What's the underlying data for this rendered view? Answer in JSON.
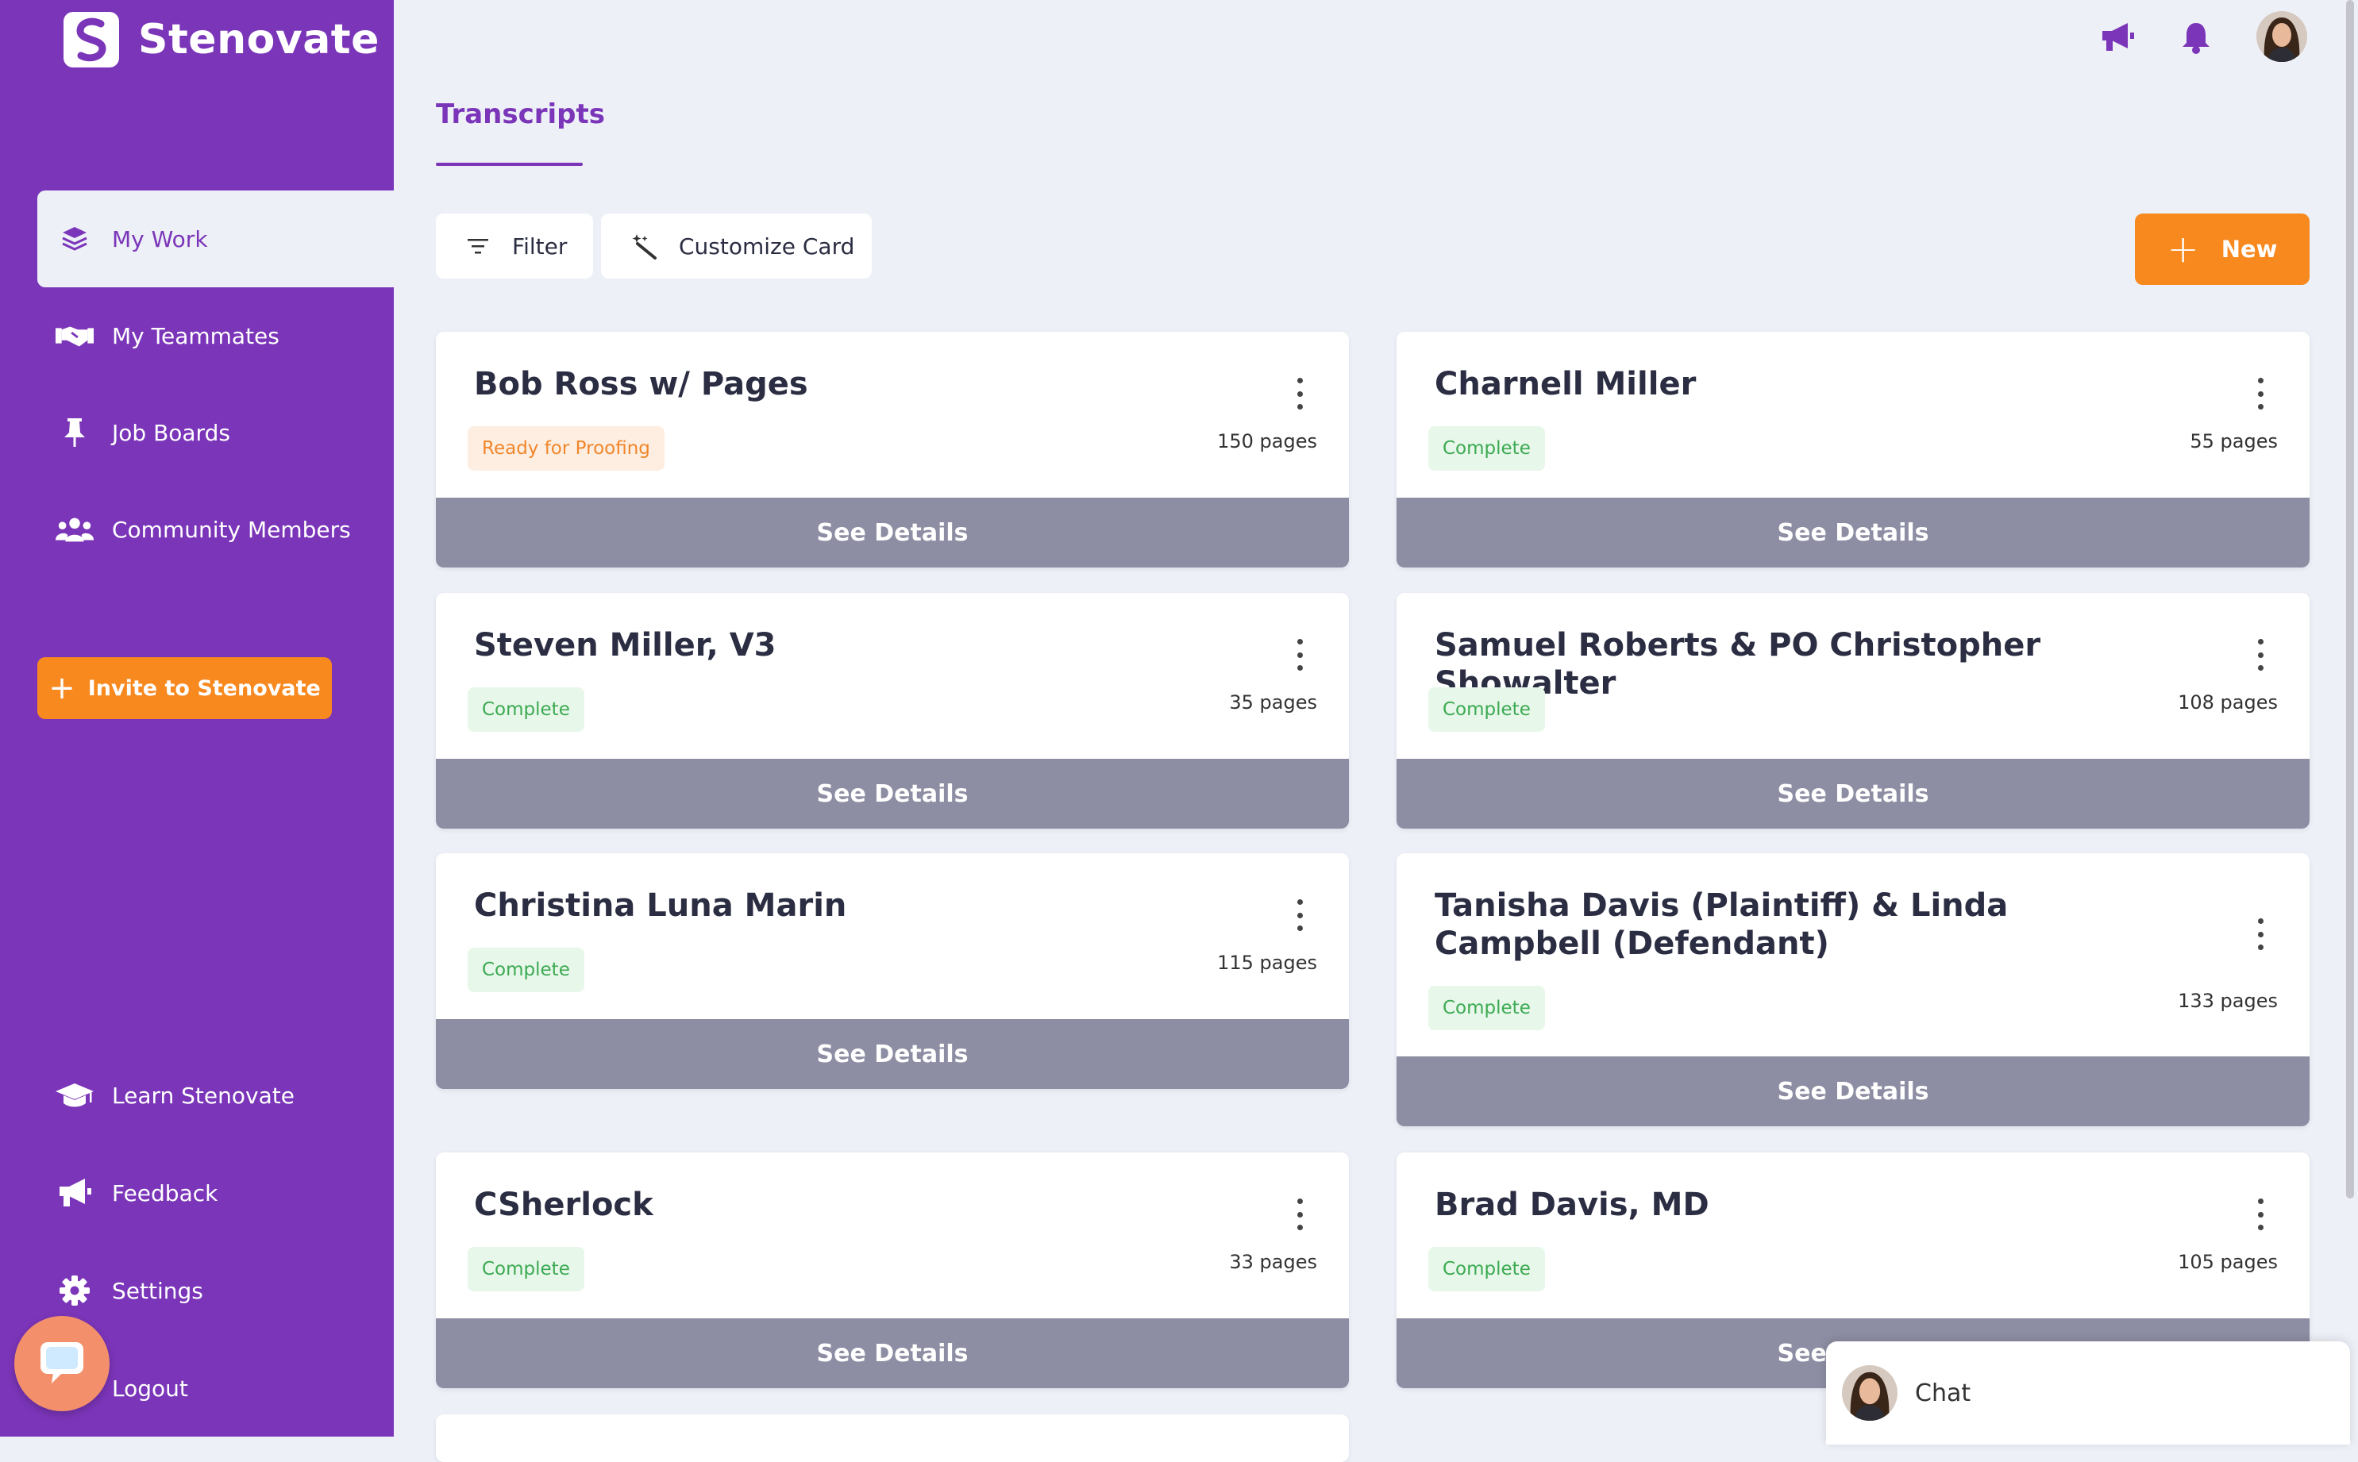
{
  "brand": {
    "name": "Stenovate",
    "color": "#7b35b9",
    "accent": "#f7891f"
  },
  "sidebar": {
    "items": [
      {
        "label": "My Work",
        "icon": "layers-icon"
      },
      {
        "label": "My Teammates",
        "icon": "handshake-icon"
      },
      {
        "label": "Job Boards",
        "icon": "pushpin-icon"
      },
      {
        "label": "Community Members",
        "icon": "users-icon"
      },
      {
        "label": "Learn Stenovate",
        "icon": "graduation-cap-icon"
      },
      {
        "label": "Feedback",
        "icon": "megaphone-icon"
      },
      {
        "label": "Settings",
        "icon": "gear-icon"
      },
      {
        "label": "Logout",
        "icon": "logout-icon"
      }
    ],
    "invite_label": "Invite to Stenovate"
  },
  "header": {
    "tab": "Transcripts"
  },
  "toolbar": {
    "filter_label": "Filter",
    "customize_label": "Customize Card",
    "new_label": "New"
  },
  "cards": [
    {
      "title": "Bob Ross w/ Pages",
      "status": "Ready for Proofing",
      "pages": "150 pages",
      "action": "See Details"
    },
    {
      "title": "Charnell Miller",
      "status": "Complete",
      "pages": "55 pages",
      "action": "See Details"
    },
    {
      "title": "Steven Miller, V3",
      "status": "Complete",
      "pages": "35 pages",
      "action": "See Details"
    },
    {
      "title": "Samuel Roberts & PO Christopher Showalter",
      "status": "Complete",
      "pages": "108 pages",
      "action": "See Details"
    },
    {
      "title": "Christina Luna Marin",
      "status": "Complete",
      "pages": "115 pages",
      "action": "See Details"
    },
    {
      "title": "Tanisha Davis (Plaintiff) & Linda Campbell (Defendant)",
      "status": "Complete",
      "pages": "133 pages",
      "action": "See Details"
    },
    {
      "title": "CSherlock",
      "status": "Complete",
      "pages": "33 pages",
      "action": "See Details"
    },
    {
      "title": "Brad Davis, MD",
      "status": "Complete",
      "pages": "105 pages",
      "action": "See Details"
    }
  ],
  "chat": {
    "label": "Chat"
  }
}
